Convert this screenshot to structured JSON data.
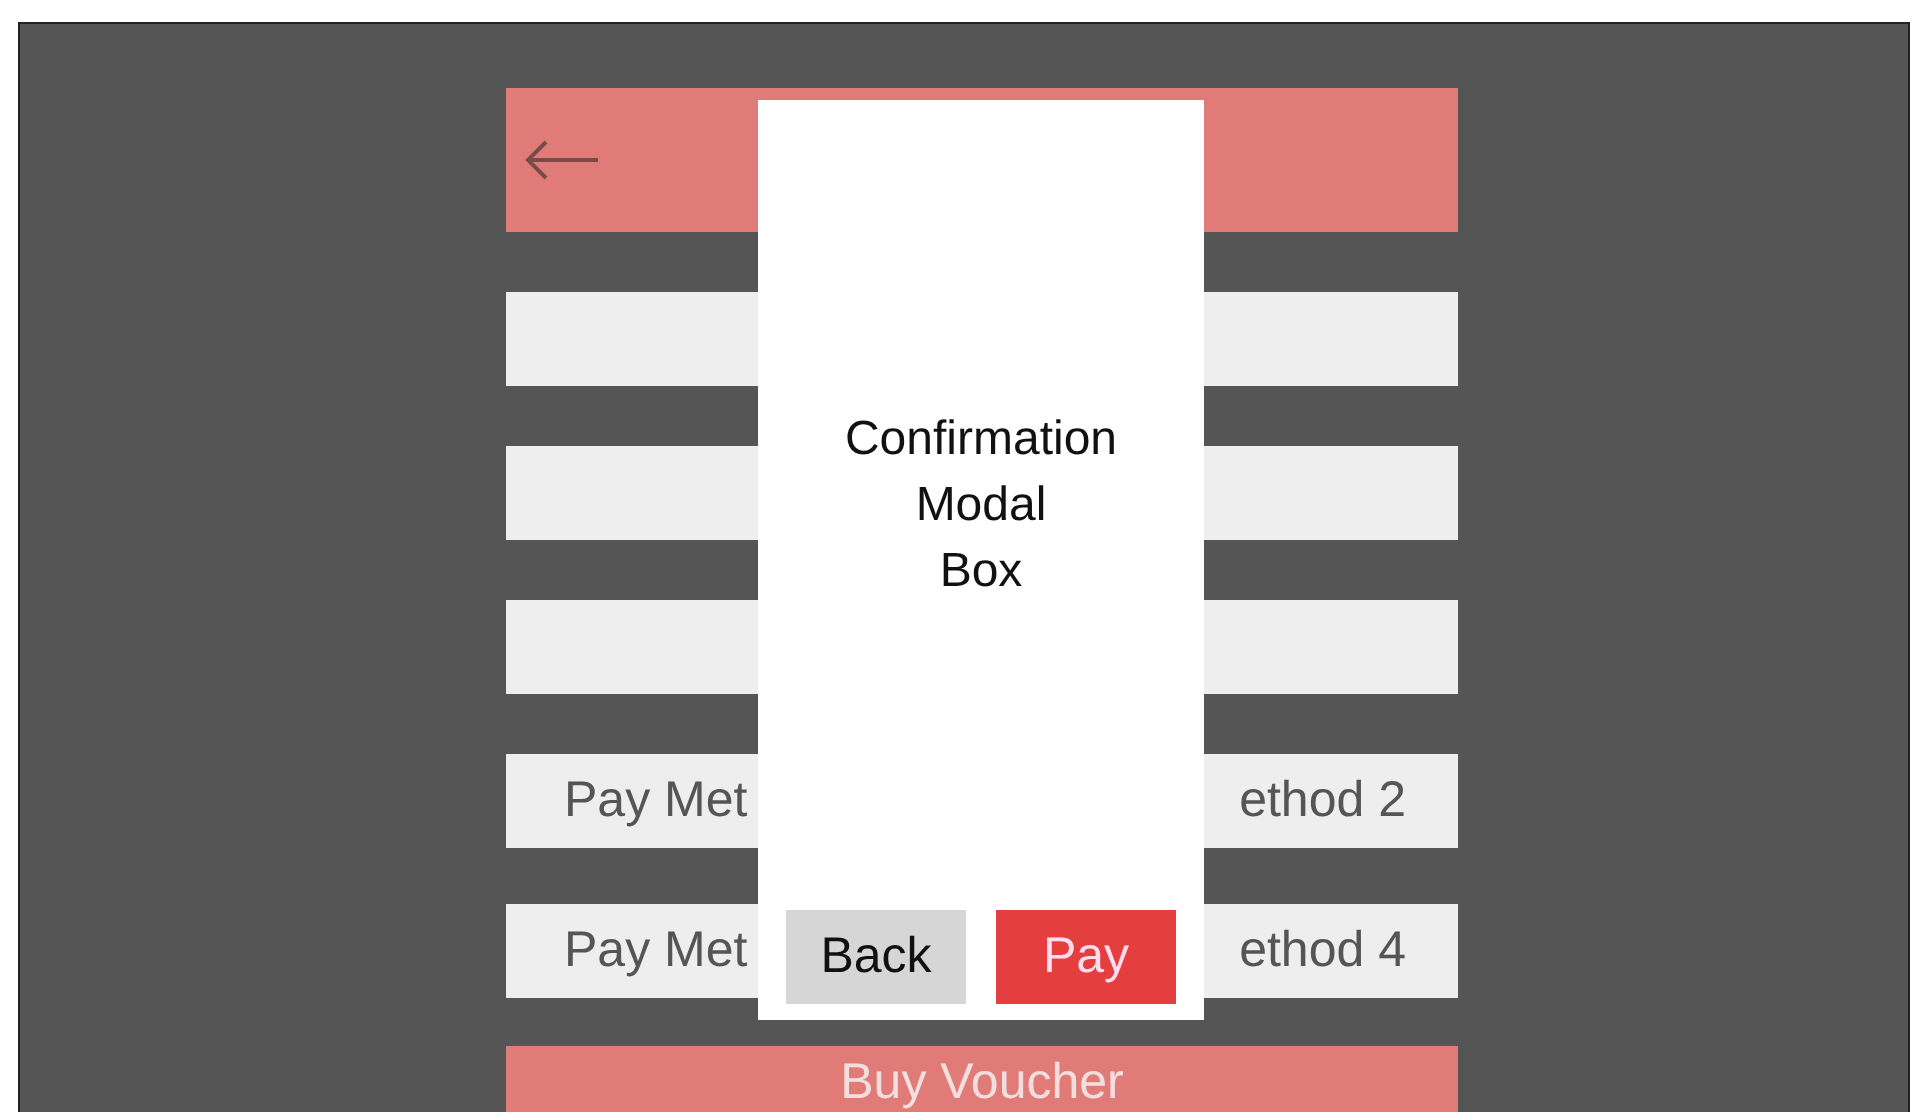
{
  "rows": [
    {
      "kind": "blank"
    },
    {
      "kind": "blank"
    },
    {
      "kind": "blank"
    },
    {
      "kind": "method_pair",
      "left": "Pay Met",
      "right": "ethod 2"
    },
    {
      "kind": "method_pair",
      "left": "Pay Met",
      "right": "ethod 4"
    }
  ],
  "primary_action": "Buy Voucher",
  "modal": {
    "message": "Confirmation\nModal\nBox",
    "buttons": [
      {
        "label": "Back",
        "kind": "secondary"
      },
      {
        "label": "Pay",
        "kind": "primary"
      }
    ]
  }
}
